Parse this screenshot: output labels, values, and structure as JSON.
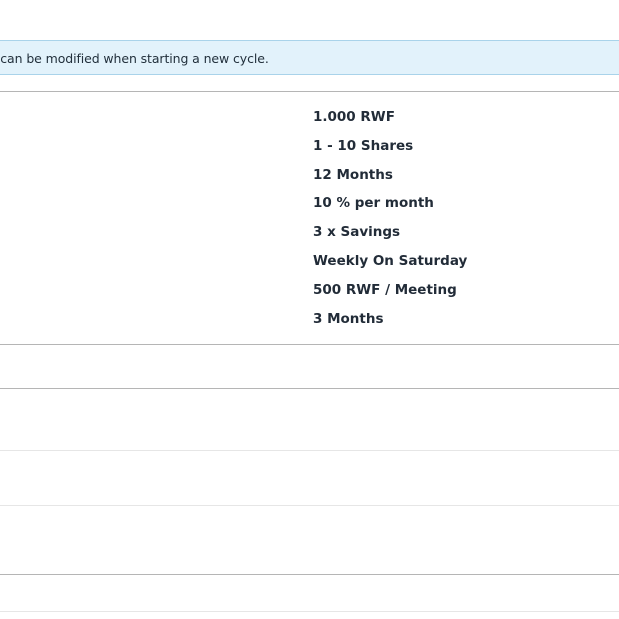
{
  "info_banner": {
    "text": "s can be modified when starting a new cycle."
  },
  "cycle_settings": {
    "values": [
      "1.000 RWF",
      "1 - 10 Shares",
      "12 Months",
      "10 % per month",
      "3 x Savings",
      "Weekly On Saturday",
      "500 RWF / Meeting",
      "3 Months"
    ]
  },
  "colors": {
    "banner_background": "#e2f2fb",
    "banner_border": "#a9d3ea",
    "divider": "#b5b5b5",
    "text": "#222c38"
  }
}
